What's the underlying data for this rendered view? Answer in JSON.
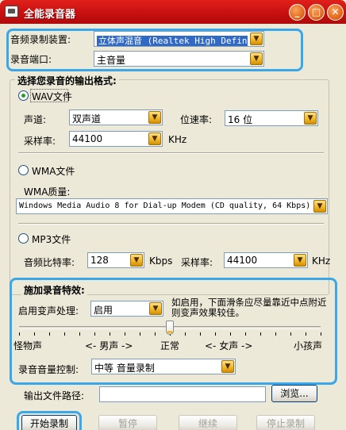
{
  "window": {
    "title": "全能录音器",
    "minimize_glyph": "_",
    "maximize_glyph": "□",
    "close_glyph": "✕"
  },
  "device": {
    "label": "音频录制装置:",
    "value": "立体声混音 (Realtek High Definit",
    "port_label": "录音端口:",
    "port_value": "主音量"
  },
  "format": {
    "group_title": "选择您录音的输出格式:",
    "wav": {
      "label": "WAV文件",
      "checked": true,
      "channel_label": "声道:",
      "channel_value": "双声道",
      "bitrate_label": "位速率:",
      "bitrate_value": "16 位",
      "samplerate_label": "采样率:",
      "samplerate_value": "44100",
      "samplerate_unit": "KHz"
    },
    "wma": {
      "label": "WMA文件",
      "checked": false,
      "quality_label": "WMA质量:",
      "quality_value": "Windows Media Audio 8 for Dial-up Modem (CD quality, 64 Kbps)"
    },
    "mp3": {
      "label": "MP3文件",
      "checked": false,
      "bitrate_label": "音频比特率:",
      "bitrate_value": "128",
      "bitrate_unit": "Kbps",
      "samplerate_label": "采样率:",
      "samplerate_value": "44100",
      "samplerate_unit": "KHz"
    }
  },
  "effects": {
    "group_title": "施加录音特效:",
    "voice_change_label": "启用变声处理:",
    "voice_change_value": "启用",
    "hint": "如启用，下面滑条应尽量靠近中点附近则变声效果较佳。",
    "slider_level": 0.5,
    "slider_labels": [
      "怪物声",
      "<- 男声 ->",
      "正常",
      "<- 女声 ->",
      "小孩声"
    ],
    "volume_label": "录音音量控制:",
    "volume_value": "中等 音量录制"
  },
  "output": {
    "path_label": "输出文件路径:",
    "path_value": "",
    "browse_label": "浏览..."
  },
  "actions": {
    "start_label": "开始录制",
    "pause_label": "暂停",
    "continue_label": "继续",
    "stop_label": "停止录制"
  },
  "colors": {
    "titlebar": "#c81010",
    "highlight_ring": "#3aa7e8",
    "selection": "#316ac5",
    "dropdown_arrow": "#f1b92a"
  }
}
